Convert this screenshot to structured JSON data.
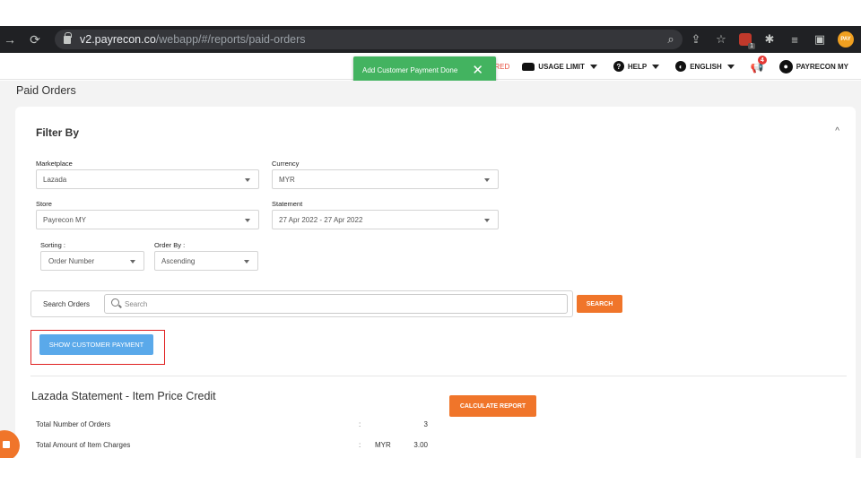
{
  "browser": {
    "url_host": "v2.payrecon.co",
    "url_path": "/webapp/#/reports/paid-orders",
    "ext_badge": "1",
    "ext_pay": "PAY"
  },
  "header": {
    "expired_text": "PIRED",
    "usage_limit": "USAGE LIMIT",
    "help": "HELP",
    "language": "ENGLISH",
    "notification_count": "4",
    "user": "PAYRECON MY"
  },
  "toast": {
    "message": "Add Customer Payment Done",
    "close": "✕"
  },
  "page": {
    "title": "Paid Orders"
  },
  "filter": {
    "title": "Filter By",
    "marketplace_label": "Marketplace",
    "marketplace_value": "Lazada",
    "currency_label": "Currency",
    "currency_value": "MYR",
    "store_label": "Store",
    "store_value": "Payrecon MY",
    "statement_label": "Statement",
    "statement_value": "27 Apr 2022 - 27 Apr 2022",
    "sorting_label": "Sorting :",
    "sorting_value": "Order Number",
    "order_by_label": "Order By :",
    "order_by_value": "Ascending"
  },
  "search": {
    "label": "Search Orders",
    "placeholder": "Search",
    "button": "SEARCH"
  },
  "actions": {
    "show_customer_payment": "SHOW CUSTOMER PAYMENT",
    "calculate_report": "CALCULATE REPORT"
  },
  "statement": {
    "title": "Lazada Statement - Item Price Credit",
    "rows": [
      {
        "label": "Total Number of Orders",
        "colon": ":",
        "currency": "",
        "value": "3"
      },
      {
        "label": "Total Amount of Item Charges",
        "colon": ":",
        "currency": "MYR",
        "value": "3.00"
      }
    ]
  }
}
